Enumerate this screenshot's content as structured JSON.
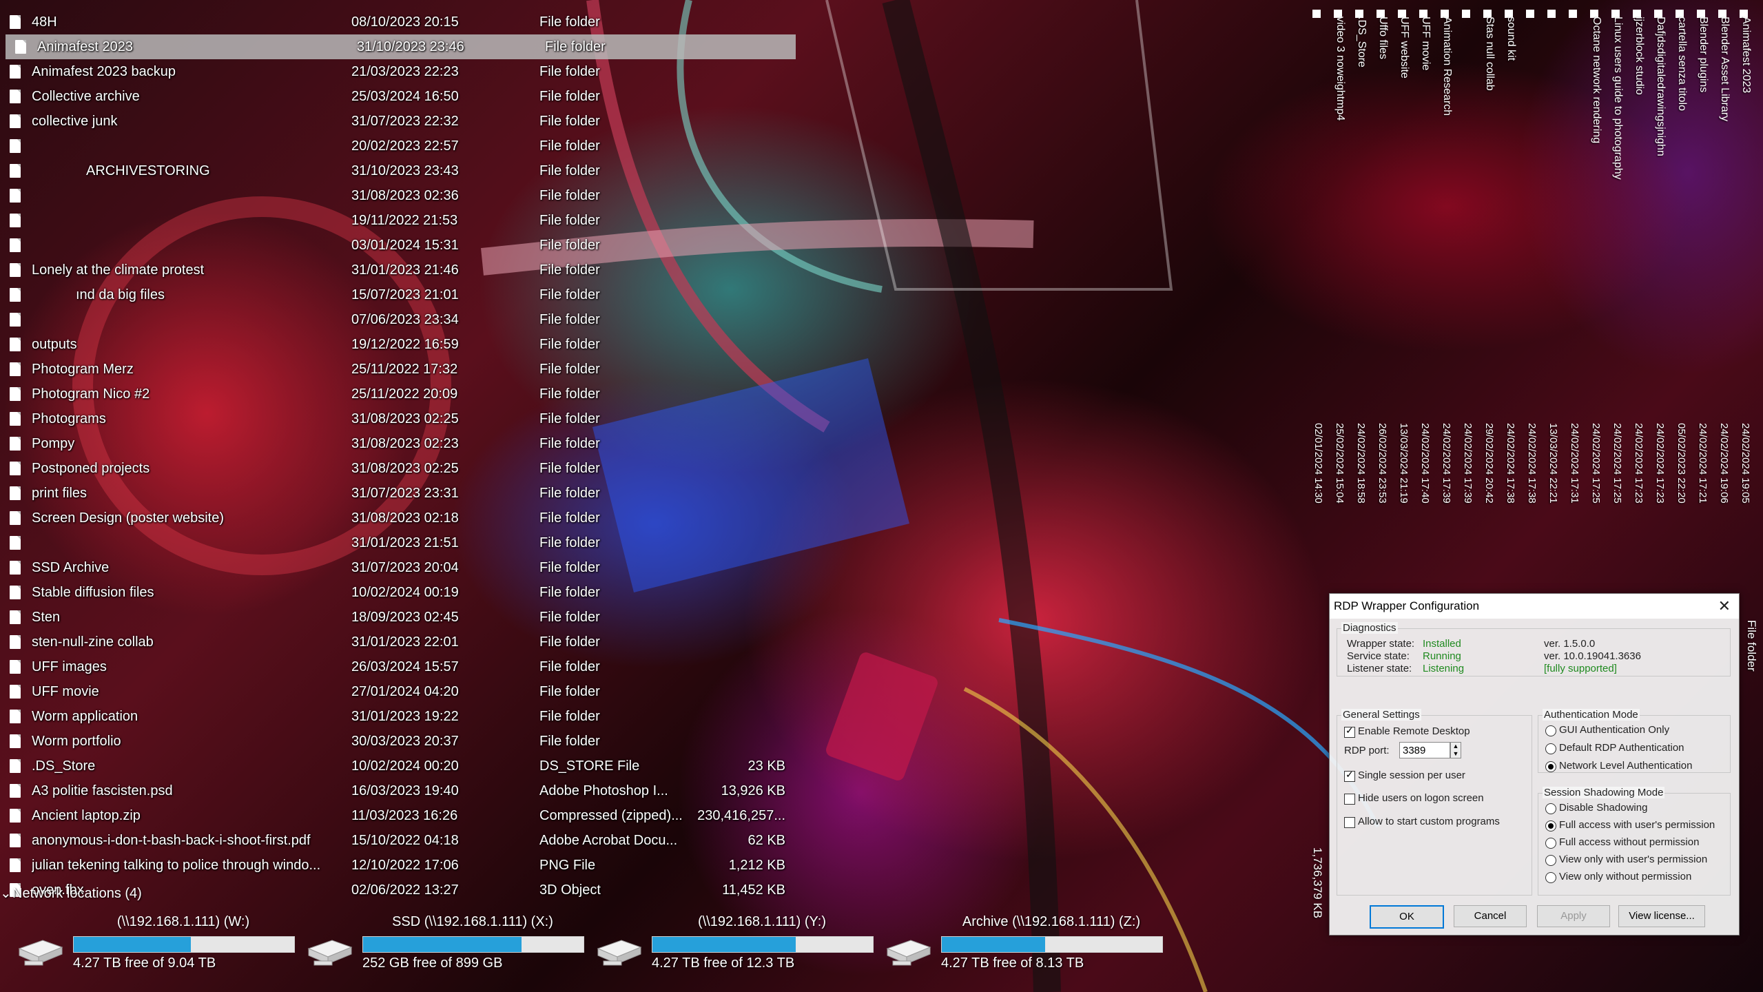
{
  "files": [
    {
      "name": "48H",
      "date": "08/10/2023 20:15",
      "type": "File folder",
      "size": "",
      "selected": false
    },
    {
      "name": "Animafest 2023",
      "date": "31/10/2023 23:46",
      "type": "File folder",
      "size": "",
      "selected": true
    },
    {
      "name": "Animafest 2023 backup",
      "date": "21/03/2023 22:23",
      "type": "File folder",
      "size": "",
      "selected": false
    },
    {
      "name": "Collective archive",
      "date": "25/03/2024 16:50",
      "type": "File folder",
      "size": "",
      "selected": false
    },
    {
      "name": "collective junk",
      "date": "31/07/2023 22:32",
      "type": "File folder",
      "size": "",
      "selected": false
    },
    {
      "name": "",
      "date": "20/02/2023 22:57",
      "type": "File folder",
      "size": "",
      "selected": false
    },
    {
      "name": "ARCHIVESTORING",
      "date": "31/10/2023 23:43",
      "type": "File folder",
      "size": "",
      "selected": false,
      "indent": true
    },
    {
      "name": "",
      "date": "31/08/2023 02:36",
      "type": "File folder",
      "size": "",
      "selected": false
    },
    {
      "name": "",
      "date": "19/11/2022 21:53",
      "type": "File folder",
      "size": "",
      "selected": false
    },
    {
      "name": "",
      "date": "03/01/2024 15:31",
      "type": "File folder",
      "size": "",
      "selected": false
    },
    {
      "name": "Lonely at the climate protest",
      "date": "31/01/2023 21:46",
      "type": "File folder",
      "size": "",
      "selected": false
    },
    {
      "name": "ınd da big files",
      "date": "15/07/2023 21:01",
      "type": "File folder",
      "size": "",
      "selected": false,
      "indent2": true
    },
    {
      "name": "",
      "date": "07/06/2023 23:34",
      "type": "File folder",
      "size": "",
      "selected": false
    },
    {
      "name": "outputs",
      "date": "19/12/2022 16:59",
      "type": "File folder",
      "size": "",
      "selected": false
    },
    {
      "name": "Photogram Merz",
      "date": "25/11/2022 17:32",
      "type": "File folder",
      "size": "",
      "selected": false
    },
    {
      "name": "Photogram Nico #2",
      "date": "25/11/2022 20:09",
      "type": "File folder",
      "size": "",
      "selected": false
    },
    {
      "name": "Photograms",
      "date": "31/08/2023 02:25",
      "type": "File folder",
      "size": "",
      "selected": false
    },
    {
      "name": "Pompy",
      "date": "31/08/2023 02:23",
      "type": "File folder",
      "size": "",
      "selected": false
    },
    {
      "name": "Postponed projects",
      "date": "31/08/2023 02:25",
      "type": "File folder",
      "size": "",
      "selected": false
    },
    {
      "name": "print files",
      "date": "31/07/2023 23:31",
      "type": "File folder",
      "size": "",
      "selected": false
    },
    {
      "name": "Screen Design (poster website)",
      "date": "31/08/2023 02:18",
      "type": "File folder",
      "size": "",
      "selected": false
    },
    {
      "name": "",
      "date": "31/01/2023 21:51",
      "type": "File folder",
      "size": "",
      "selected": false
    },
    {
      "name": "SSD Archive",
      "date": "31/07/2023 20:04",
      "type": "File folder",
      "size": "",
      "selected": false
    },
    {
      "name": "Stable diffusion files",
      "date": "10/02/2024 00:19",
      "type": "File folder",
      "size": "",
      "selected": false
    },
    {
      "name": "Sten",
      "date": "18/09/2023 02:45",
      "type": "File folder",
      "size": "",
      "selected": false
    },
    {
      "name": "sten-null-zine collab",
      "date": "31/01/2023 22:01",
      "type": "File folder",
      "size": "",
      "selected": false
    },
    {
      "name": "UFF images",
      "date": "26/03/2024 15:57",
      "type": "File folder",
      "size": "",
      "selected": false
    },
    {
      "name": "UFF movie",
      "date": "27/01/2024 04:20",
      "type": "File folder",
      "size": "",
      "selected": false
    },
    {
      "name": "Worm application",
      "date": "31/01/2023 19:22",
      "type": "File folder",
      "size": "",
      "selected": false
    },
    {
      "name": "Worm portfolio",
      "date": "30/03/2023 20:37",
      "type": "File folder",
      "size": "",
      "selected": false
    },
    {
      "name": ".DS_Store",
      "date": "10/02/2024 00:20",
      "type": "DS_STORE File",
      "size": "23 KB",
      "selected": false
    },
    {
      "name": "A3 politie fascisten.psd",
      "date": "16/03/2023 19:40",
      "type": "Adobe Photoshop I...",
      "size": "13,926 KB",
      "selected": false
    },
    {
      "name": "Ancient laptop.zip",
      "date": "11/03/2023 16:26",
      "type": "Compressed (zipped)...",
      "size": "230,416,257...",
      "selected": false
    },
    {
      "name": "anonymous-i-don-t-bash-back-i-shoot-first.pdf",
      "date": "15/10/2022 04:18",
      "type": "Adobe Acrobat Docu...",
      "size": "62 KB",
      "selected": false
    },
    {
      "name": "julian tekening talking to police through windo...",
      "date": "12/10/2022 17:06",
      "type": "PNG File",
      "size": "1,212 KB",
      "selected": false
    },
    {
      "name": "oven.fbx",
      "date": "02/06/2022 13:27",
      "type": "3D Object",
      "size": "11,452 KB",
      "selected": false
    }
  ],
  "network": {
    "header": "Network locations (4)",
    "drives": [
      {
        "name": "(\\\\192.168.1.111) (W:)",
        "free": "4.27 TB free of 9.04 TB",
        "used_fraction": 0.53
      },
      {
        "name": "SSD (\\\\192.168.1.111) (X:)",
        "free": "252 GB free of 899 GB",
        "used_fraction": 0.72
      },
      {
        "name": "(\\\\192.168.1.111) (Y:)",
        "free": "4.27 TB free of 12.3 TB",
        "used_fraction": 0.65
      },
      {
        "name": "Archive (\\\\192.168.1.111) (Z:)",
        "free": "4.27 TB free of 8.13 TB",
        "used_fraction": 0.47
      }
    ]
  },
  "vertical_items": [
    {
      "name": "Animafest 2023",
      "date": "24/02/2024 19:05"
    },
    {
      "name": "Blender Asset Library",
      "date": "24/02/2024 19:06"
    },
    {
      "name": "Blender plugins",
      "date": "24/02/2024 17:21"
    },
    {
      "name": "cartella senza titolo",
      "date": "05/02/2023 22:20"
    },
    {
      "name": "Dafjdsdigitaledrawingsjnighn",
      "date": "24/02/2024 17:23"
    },
    {
      "name": "ijzerblock studio",
      "date": "24/02/2024 17:23"
    },
    {
      "name": "Linux users guide to photography",
      "date": "24/02/2024 17:25"
    },
    {
      "name": "Octane network rendering",
      "date": "24/02/2024 17:25"
    },
    {
      "name": "",
      "date": "24/02/2024 17:31"
    },
    {
      "name": "",
      "date": "13/03/2024 22:21"
    },
    {
      "name": "",
      "date": "24/02/2024 17:38"
    },
    {
      "name": "sound kit",
      "date": "24/02/2024 17:38"
    },
    {
      "name": "Stas null collab",
      "date": "29/02/2024 20:42"
    },
    {
      "name": "",
      "date": "24/02/2024 17:39"
    },
    {
      "name": "Animation Research",
      "date": "24/02/2024 17:39"
    },
    {
      "name": "UFF movie",
      "date": "24/02/2024 17:40"
    },
    {
      "name": "UFF website",
      "date": "13/03/2024 21:19"
    },
    {
      "name": "Uffo files",
      "date": "26/02/2024 23:53"
    },
    {
      "name": ".DS_Store",
      "date": "24/02/2024 18:58"
    },
    {
      "name": "video 3 noweightmp4",
      "date": "25/02/2024 15:04"
    },
    {
      "name": "",
      "date": "02/01/2024 14:30"
    }
  ],
  "side": {
    "file_folder": "File folder",
    "size_text": "1,736,379 KB"
  },
  "rdp": {
    "title": "RDP Wrapper Configuration",
    "close": "✕",
    "diagnostics": {
      "legend": "Diagnostics",
      "wrapper_label": "Wrapper state:",
      "wrapper_value": "Installed",
      "wrapper_ver": "ver. 1.5.0.0",
      "service_label": "Service state:",
      "service_value": "Running",
      "service_ver": "ver. 10.0.19041.3636",
      "listener_label": "Listener state:",
      "listener_value": "Listening",
      "listener_support": "[fully supported]"
    },
    "general": {
      "legend": "General Settings",
      "enable_rd": "Enable Remote Desktop",
      "enable_rd_checked": true,
      "port_label": "RDP port:",
      "port_value": "3389",
      "single_session": "Single session per user",
      "single_session_checked": true,
      "hide_users": "Hide users on logon screen",
      "hide_users_checked": false,
      "custom_programs": "Allow to start custom programs",
      "custom_programs_checked": false
    },
    "auth": {
      "legend": "Authentication Mode",
      "options": [
        "GUI Authentication Only",
        "Default RDP Authentication",
        "Network Level Authentication"
      ],
      "selected": 2
    },
    "shadow": {
      "legend": "Session Shadowing Mode",
      "options": [
        "Disable Shadowing",
        "Full access with user's permission",
        "Full access without permission",
        "View only with user's permission",
        "View only without permission"
      ],
      "selected": 1
    },
    "buttons": {
      "ok": "OK",
      "cancel": "Cancel",
      "apply": "Apply",
      "license": "View license..."
    }
  }
}
